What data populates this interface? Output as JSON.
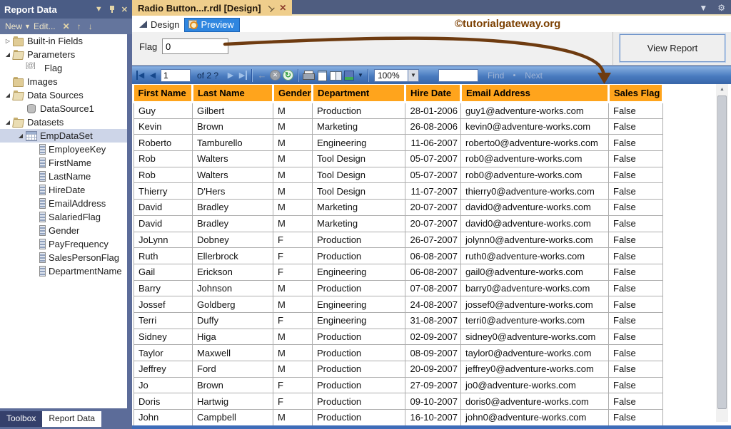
{
  "sidebar": {
    "title": "Report Data",
    "toolbar": {
      "new_label": "New",
      "edit_label": "Edit..."
    },
    "tree": [
      {
        "label": "Built-in Fields",
        "depth": 0,
        "icon": "folder",
        "expander": "collapsed"
      },
      {
        "label": "Parameters",
        "depth": 0,
        "icon": "folder-open",
        "expander": "expanded"
      },
      {
        "label": "Flag",
        "depth": 1,
        "icon": "param"
      },
      {
        "label": "Images",
        "depth": 0,
        "icon": "folder"
      },
      {
        "label": "Data Sources",
        "depth": 0,
        "icon": "folder-open",
        "expander": "expanded"
      },
      {
        "label": "DataSource1",
        "depth": 1,
        "icon": "database"
      },
      {
        "label": "Datasets",
        "depth": 0,
        "icon": "folder-open",
        "expander": "expanded"
      },
      {
        "label": "EmpDataSet",
        "depth": 1,
        "icon": "table",
        "expander": "expanded",
        "selected": true
      },
      {
        "label": "EmployeeKey",
        "depth": 2,
        "icon": "field"
      },
      {
        "label": "FirstName",
        "depth": 2,
        "icon": "field"
      },
      {
        "label": "LastName",
        "depth": 2,
        "icon": "field"
      },
      {
        "label": "HireDate",
        "depth": 2,
        "icon": "field"
      },
      {
        "label": "EmailAddress",
        "depth": 2,
        "icon": "field"
      },
      {
        "label": "SalariedFlag",
        "depth": 2,
        "icon": "field"
      },
      {
        "label": "Gender",
        "depth": 2,
        "icon": "field"
      },
      {
        "label": "PayFrequency",
        "depth": 2,
        "icon": "field"
      },
      {
        "label": "SalesPersonFlag",
        "depth": 2,
        "icon": "field"
      },
      {
        "label": "DepartmentName",
        "depth": 2,
        "icon": "field"
      }
    ],
    "bottom_tabs": [
      {
        "label": "Toolbox",
        "active": false
      },
      {
        "label": "Report Data",
        "active": true
      }
    ]
  },
  "document_tab": {
    "title": "Radio Button...r.rdl [Design]"
  },
  "mode_bar": {
    "design_label": "Design",
    "preview_label": "Preview",
    "watermark": "©tutorialgateway.org"
  },
  "parameters": {
    "flag_label": "Flag",
    "flag_value": "0",
    "view_report_label": "View Report"
  },
  "viewer_toolbar": {
    "current_page": "1",
    "of_label": "of 2 ?",
    "zoom_value": "100%",
    "find_value": "",
    "find_label": "Find",
    "next_label": "Next"
  },
  "report": {
    "columns": [
      "First Name",
      "Last Name",
      "Gender",
      "Department",
      "Hire Date",
      "Email Address",
      "Sales Flag"
    ],
    "rows": [
      [
        "Guy",
        "Gilbert",
        "M",
        "Production",
        "28-01-2006",
        "guy1@adventure-works.com",
        "False"
      ],
      [
        "Kevin",
        "Brown",
        "M",
        "Marketing",
        "26-08-2006",
        "kevin0@adventure-works.com",
        "False"
      ],
      [
        "Roberto",
        "Tamburello",
        "M",
        "Engineering",
        "11-06-2007",
        "roberto0@adventure-works.com",
        "False"
      ],
      [
        "Rob",
        "Walters",
        "M",
        "Tool Design",
        "05-07-2007",
        "rob0@adventure-works.com",
        "False"
      ],
      [
        "Rob",
        "Walters",
        "M",
        "Tool Design",
        "05-07-2007",
        "rob0@adventure-works.com",
        "False"
      ],
      [
        "Thierry",
        "D'Hers",
        "M",
        "Tool Design",
        "11-07-2007",
        "thierry0@adventure-works.com",
        "False"
      ],
      [
        "David",
        "Bradley",
        "M",
        "Marketing",
        "20-07-2007",
        "david0@adventure-works.com",
        "False"
      ],
      [
        "David",
        "Bradley",
        "M",
        "Marketing",
        "20-07-2007",
        "david0@adventure-works.com",
        "False"
      ],
      [
        "JoLynn",
        "Dobney",
        "F",
        "Production",
        "26-07-2007",
        "jolynn0@adventure-works.com",
        "False"
      ],
      [
        "Ruth",
        "Ellerbrock",
        "F",
        "Production",
        "06-08-2007",
        "ruth0@adventure-works.com",
        "False"
      ],
      [
        "Gail",
        "Erickson",
        "F",
        "Engineering",
        "06-08-2007",
        "gail0@adventure-works.com",
        "False"
      ],
      [
        "Barry",
        "Johnson",
        "M",
        "Production",
        "07-08-2007",
        "barry0@adventure-works.com",
        "False"
      ],
      [
        "Jossef",
        "Goldberg",
        "M",
        "Engineering",
        "24-08-2007",
        "jossef0@adventure-works.com",
        "False"
      ],
      [
        "Terri",
        "Duffy",
        "F",
        "Engineering",
        "31-08-2007",
        "terri0@adventure-works.com",
        "False"
      ],
      [
        "Sidney",
        "Higa",
        "M",
        "Production",
        "02-09-2007",
        "sidney0@adventure-works.com",
        "False"
      ],
      [
        "Taylor",
        "Maxwell",
        "M",
        "Production",
        "08-09-2007",
        "taylor0@adventure-works.com",
        "False"
      ],
      [
        "Jeffrey",
        "Ford",
        "M",
        "Production",
        "20-09-2007",
        "jeffrey0@adventure-works.com",
        "False"
      ],
      [
        "Jo",
        "Brown",
        "F",
        "Production",
        "27-09-2007",
        "jo0@adventure-works.com",
        "False"
      ],
      [
        "Doris",
        "Hartwig",
        "F",
        "Production",
        "09-10-2007",
        "doris0@adventure-works.com",
        "False"
      ],
      [
        "John",
        "Campbell",
        "M",
        "Production",
        "16-10-2007",
        "john0@adventure-works.com",
        "False"
      ]
    ]
  },
  "colors": {
    "table_header_bg": "#FFA41C",
    "preview_button_bg": "#2F86E0",
    "doc_tab_bg": "#EFCE8C",
    "panel_header_bg": "#4A5C85",
    "watermark_color": "#7B3F00",
    "arrow_color": "#6E3B10",
    "viewer_toolbar_top": "#8AB2E2",
    "viewer_toolbar_bottom": "#3765A8"
  }
}
